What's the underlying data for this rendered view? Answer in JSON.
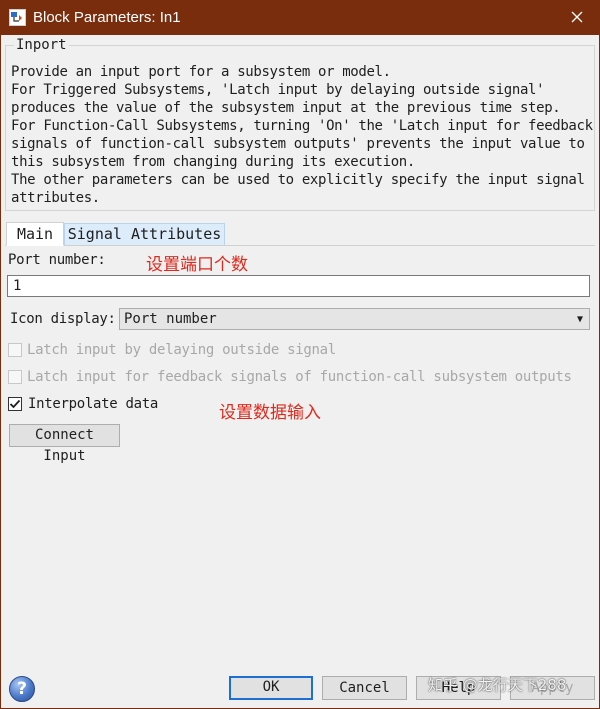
{
  "window": {
    "title": "Block Parameters: In1",
    "close_glyph": "✕"
  },
  "group": {
    "legend": "Inport",
    "description": "Provide an input port for a subsystem or model.\nFor Triggered Subsystems, 'Latch input by delaying outside signal'\nproduces the value of the subsystem input at the previous time step.\nFor Function-Call Subsystems, turning 'On' the 'Latch input for feedback\nsignals of function-call subsystem outputs' prevents the input value to\nthis subsystem from changing during its execution.\nThe other parameters can be used to explicitly specify the input signal\nattributes."
  },
  "tabs": [
    {
      "label": "Main",
      "active": true
    },
    {
      "label": "Signal Attributes",
      "active": false
    }
  ],
  "main": {
    "port_number_label": "Port number:",
    "port_number_value": "1",
    "port_annotation": "设置端口个数",
    "icon_display_label": "Icon display:",
    "icon_display_value": "Port number",
    "latch_delay_label": "Latch input by delaying outside signal",
    "latch_feedback_label": "Latch input for feedback signals of function-call subsystem outputs",
    "interpolate_label": "Interpolate data",
    "interpolate_annotation": "设置数据输入",
    "connect_input_label": "Connect Input"
  },
  "footer": {
    "help_glyph": "?",
    "ok_label": "OK",
    "cancel_label": "Cancel",
    "help_label": "Help",
    "apply_label": "Apply",
    "watermark": "知乎 @龙行天下288"
  },
  "colors": {
    "titlebar": "#7a2d0c",
    "annotation": "#e0291c",
    "tab_inactive": "#dcecfb",
    "ok_border": "#1e6fd4"
  }
}
